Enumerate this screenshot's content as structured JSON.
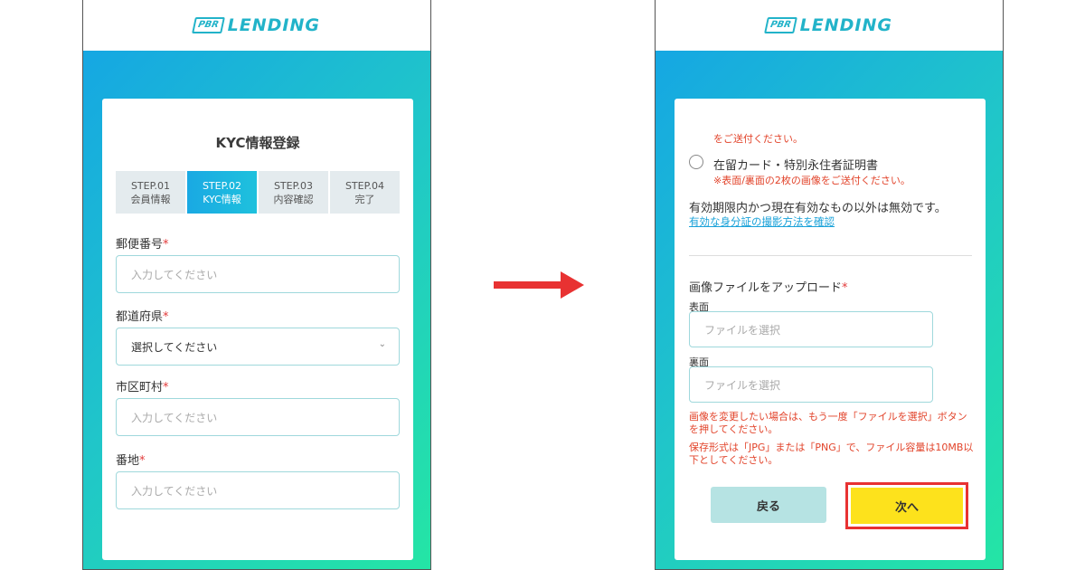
{
  "brand": {
    "badge": "PBR",
    "name": "LENDING"
  },
  "left": {
    "title": "KYC情報登録",
    "steps": [
      {
        "num": "STEP.01",
        "label": "会員情報"
      },
      {
        "num": "STEP.02",
        "label": "KYC情報"
      },
      {
        "num": "STEP.03",
        "label": "内容確認"
      },
      {
        "num": "STEP.04",
        "label": "完了"
      }
    ],
    "fields": {
      "postal": {
        "label": "郵便番号",
        "placeholder": "入力してください"
      },
      "prefecture": {
        "label": "都道府県",
        "value": "選択してください"
      },
      "city": {
        "label": "市区町村",
        "placeholder": "入力してください"
      },
      "address": {
        "label": "番地",
        "placeholder": "入力してください"
      }
    },
    "required_mark": "*"
  },
  "right": {
    "top_note": "をご送付ください。",
    "radio_label": "在留カード・特別永住者証明書",
    "radio_note": "※表面/裏面の2枚の画像をご送付ください。",
    "validity": "有効期限内かつ現在有効なもの以外は無効です。",
    "link": "有効な身分証の撮影方法を確認",
    "upload_label": "画像ファイルをアップロード",
    "front_label": "表面",
    "front_placeholder": "ファイルを選択",
    "back_label": "裏面",
    "back_placeholder": "ファイルを選択",
    "note1": "画像を変更したい場合は、もう一度「ファイルを選択」ボタンを押してください。",
    "note2": "保存形式は「JPG」または「PNG」で、ファイル容量は10MB以下としてください。",
    "back_button": "戻る",
    "next_button": "次へ"
  },
  "colors": {
    "accent": "#22b3c9",
    "highlight": "#e83232",
    "next": "#fde21c",
    "error": "#e2432a"
  }
}
